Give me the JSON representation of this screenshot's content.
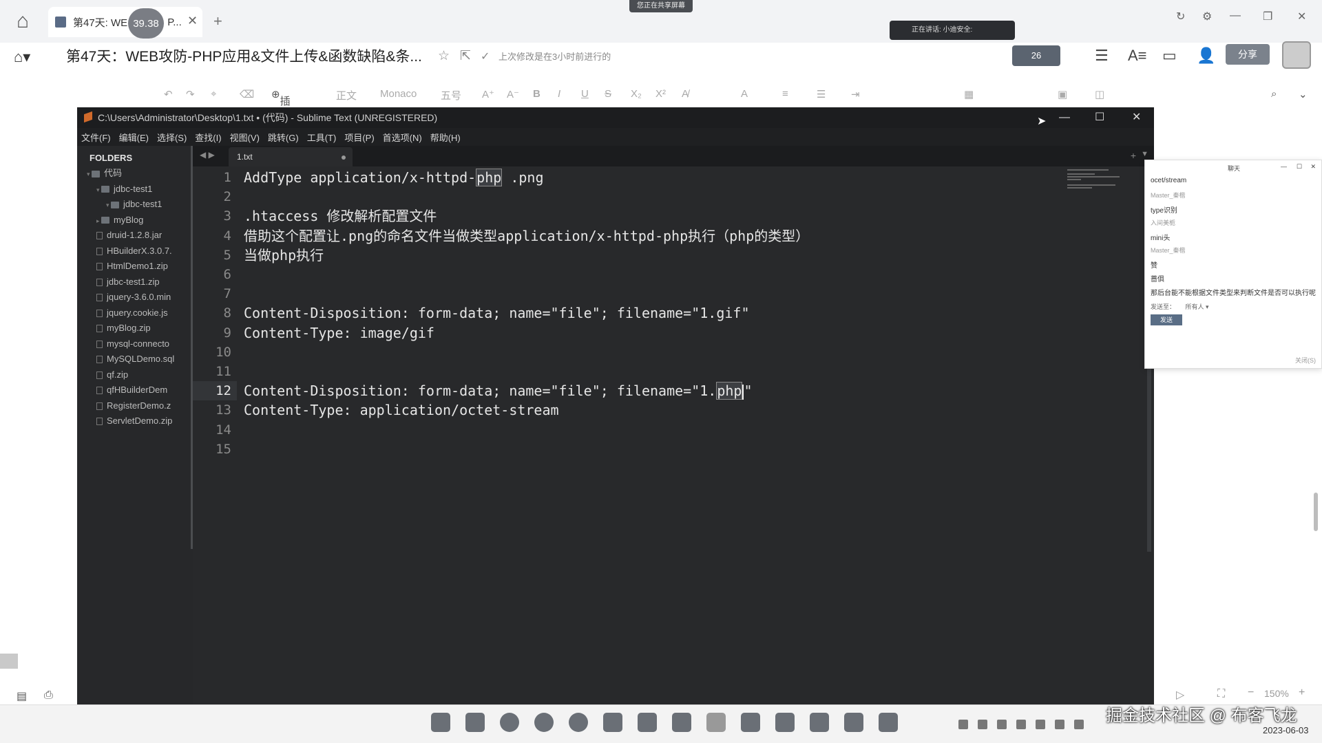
{
  "outer": {
    "tab_title": "第47天: WE",
    "tab_title_tail": "P...",
    "timer": "39.38",
    "share_banner": "您正在共享屏幕",
    "speaking": "正在讲话: 小迪安全:",
    "doc_title": "第47天：WEB攻防-PHP应用&文件上传&函数缺陷&条...",
    "saved_status": "上次修改是在3小时前进行的",
    "badge_count": "26",
    "share_label": "分享",
    "ribbon": {
      "insert": "插入",
      "body": "正文",
      "font": "Monaco",
      "size": "五号"
    },
    "zoom": "150%",
    "watermark": "掘金技术社区 @ 布客飞龙",
    "date": "2023-06-03"
  },
  "sublime": {
    "title": "C:\\Users\\Administrator\\Desktop\\1.txt • (代码) - Sublime Text (UNREGISTERED)",
    "menu": [
      "文件(F)",
      "编辑(E)",
      "选择(S)",
      "查找(I)",
      "视图(V)",
      "跳转(G)",
      "工具(T)",
      "项目(P)",
      "首选项(N)",
      "帮助(H)"
    ],
    "folders_header": "FOLDERS",
    "tree": [
      {
        "label": "代码",
        "type": "folder",
        "indent": 0
      },
      {
        "label": "jdbc-test1",
        "type": "folder",
        "indent": 1
      },
      {
        "label": "jdbc-test1",
        "type": "folder",
        "indent": 2
      },
      {
        "label": "myBlog",
        "type": "folder",
        "indent": 1
      },
      {
        "label": "druid-1.2.8.jar",
        "type": "file",
        "indent": 1
      },
      {
        "label": "HBuilderX.3.0.7.",
        "type": "file",
        "indent": 1
      },
      {
        "label": "HtmlDemo1.zip",
        "type": "file",
        "indent": 1
      },
      {
        "label": "jdbc-test1.zip",
        "type": "file",
        "indent": 1
      },
      {
        "label": "jquery-3.6.0.min",
        "type": "file",
        "indent": 1
      },
      {
        "label": "jquery.cookie.js",
        "type": "file",
        "indent": 1
      },
      {
        "label": "myBlog.zip",
        "type": "file",
        "indent": 1
      },
      {
        "label": "mysql-connecto",
        "type": "file",
        "indent": 1
      },
      {
        "label": "MySQLDemo.sql",
        "type": "file",
        "indent": 1
      },
      {
        "label": "qf.zip",
        "type": "file",
        "indent": 1
      },
      {
        "label": "qfHBuilderDem",
        "type": "file",
        "indent": 1
      },
      {
        "label": "RegisterDemo.z",
        "type": "file",
        "indent": 1
      },
      {
        "label": "ServletDemo.zip",
        "type": "file",
        "indent": 1
      }
    ],
    "file_tab": "1.txt",
    "active_line": 12,
    "lines": [
      {
        "n": "1",
        "text": "AddType application/x-httpd-",
        "sel": "php",
        "after": " .png"
      },
      {
        "n": "2",
        "text": ""
      },
      {
        "n": "3",
        "text": ".htaccess 修改解析配置文件"
      },
      {
        "n": "4",
        "text": "借助这个配置让.png的命名文件当做类型application/x-httpd-php执行（php的类型）"
      },
      {
        "n": "5",
        "text": "当做php执行"
      },
      {
        "n": "6",
        "text": ""
      },
      {
        "n": "7",
        "text": ""
      },
      {
        "n": "8",
        "text": "Content-Disposition: form-data; name=\"file\"; filename=\"1.gif\""
      },
      {
        "n": "9",
        "text": "Content-Type: image/gif"
      },
      {
        "n": "10",
        "text": ""
      },
      {
        "n": "11",
        "text": ""
      },
      {
        "n": "12",
        "text": "Content-Disposition: form-data; name=\"file\"; filename=\"1.",
        "sel": "php",
        "after": "\"",
        "caret": true
      },
      {
        "n": "13",
        "text": "Content-Type: application/octet-stream"
      },
      {
        "n": "14",
        "text": ""
      },
      {
        "n": "15",
        "text": ""
      }
    ]
  },
  "chat": {
    "header": "聊天",
    "messages": [
      {
        "text": "ocet/stream",
        "sender": false
      },
      {
        "text": "Master_秦楷",
        "sender": true
      },
      {
        "text": "type识别",
        "sender": false
      },
      {
        "text": "入间美栀",
        "sender": true
      },
      {
        "text": "mini头",
        "sender": false
      },
      {
        "text": "Master_秦楷",
        "sender": true
      },
      {
        "text": "赞",
        "sender": false
      },
      {
        "text": "蔷俱",
        "sender": false
      },
      {
        "text": "那后台能不能根据文件类型来判断文件是否可以执行呢",
        "sender": false
      }
    ],
    "send_to": "发送至：",
    "send_to_value": "所有人",
    "send_label": "发送",
    "close_label": "关闭(S)"
  }
}
